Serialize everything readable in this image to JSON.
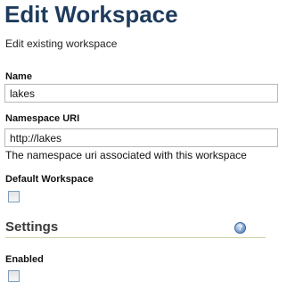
{
  "header": {
    "title": "Edit Workspace",
    "description": "Edit existing workspace"
  },
  "form": {
    "name": {
      "label": "Name",
      "value": "lakes"
    },
    "namespace_uri": {
      "label": "Namespace URI",
      "value": "http://lakes",
      "help": "The namespace uri associated with this workspace"
    },
    "default_workspace": {
      "label": "Default Workspace",
      "checked": false
    }
  },
  "settings": {
    "heading": "Settings",
    "help_icon": "question-icon",
    "help_glyph": "?",
    "enabled": {
      "label": "Enabled",
      "checked": false
    }
  }
}
